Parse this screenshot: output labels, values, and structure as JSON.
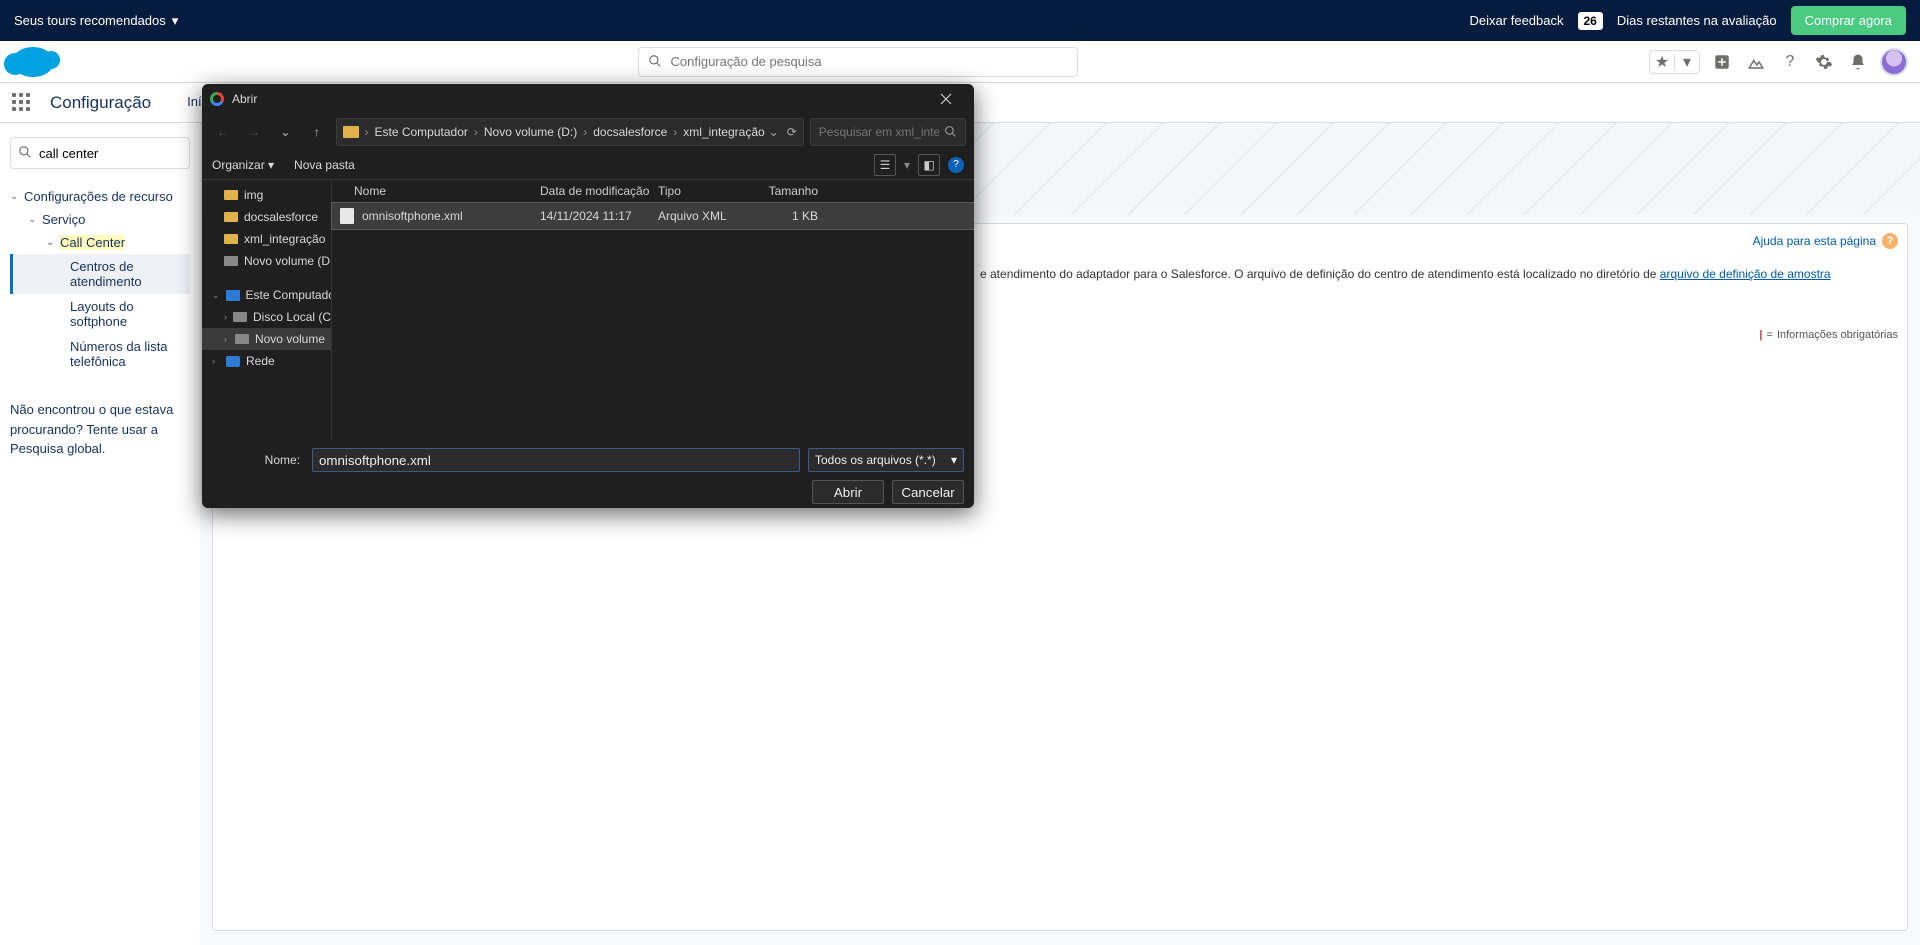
{
  "trial": {
    "tours": "Seus tours recomendados",
    "feedback": "Deixar feedback",
    "days": "26",
    "days_label": "Dias restantes na avaliação",
    "buy": "Comprar agora"
  },
  "header": {
    "search_placeholder": "Configuração de pesquisa"
  },
  "appbar": {
    "app": "Configuração",
    "tab_home": "Início"
  },
  "sidebar": {
    "search_value": "call center",
    "group": "Configurações de recurso",
    "servico": "Serviço",
    "callcenter": "Call Center",
    "leaf_centros": "Centros de atendimento",
    "leaf_layouts": "Layouts do softphone",
    "leaf_numeros": "Números da lista telefônica",
    "notfound": "Não encontrou o que estava procurando? Tente usar a Pesquisa global."
  },
  "main": {
    "help": "Ajuda para esta página",
    "para": "e atendimento do adaptador para o Salesforce. O arquivo de definição do centro de atendimento está localizado no diretório de",
    "link": "arquivo de definição de amostra",
    "req": "Informações obrigatórias"
  },
  "dialog": {
    "title": "Abrir",
    "path": [
      "Este Computador",
      "Novo volume (D:)",
      "docsalesforce",
      "xml_integração"
    ],
    "search_placeholder": "Pesquisar em xml_integração",
    "organize": "Organizar",
    "newfolder": "Nova pasta",
    "cols": {
      "name": "Nome",
      "date": "Data de modificação",
      "type": "Tipo",
      "size": "Tamanho"
    },
    "tree": {
      "img": "img",
      "docsalesforce": "docsalesforce",
      "xml": "xml_integração",
      "novo": "Novo volume (D",
      "pc": "Este Computado",
      "localc": "Disco Local (C",
      "novovol": "Novo volume",
      "rede": "Rede"
    },
    "file": {
      "name": "omnisoftphone.xml",
      "date": "14/11/2024 11:17",
      "type": "Arquivo XML",
      "size": "1 KB"
    },
    "name_lbl": "Nome:",
    "name_val": "omnisoftphone.xml",
    "filter": "Todos os arquivos (*.*)",
    "open": "Abrir",
    "cancel": "Cancelar"
  }
}
